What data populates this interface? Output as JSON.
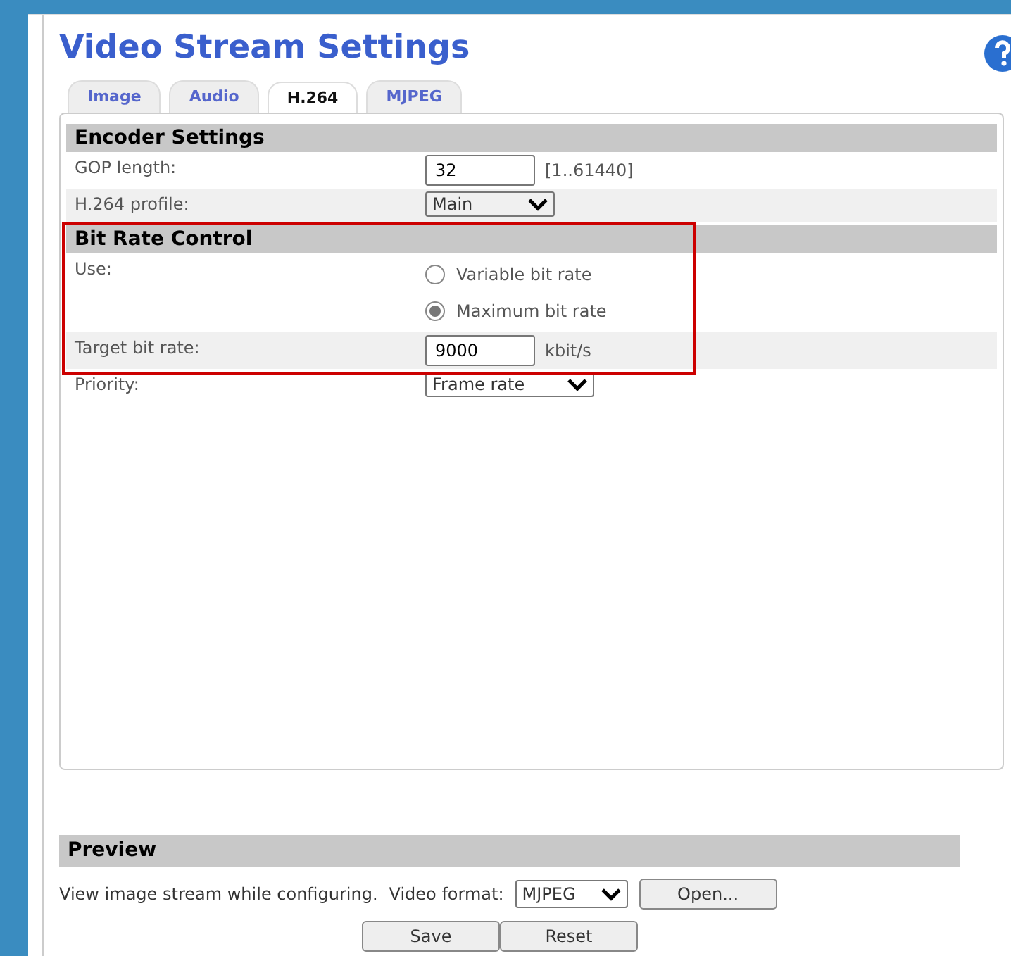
{
  "title": "Video Stream Settings",
  "tabs": [
    {
      "label": "Image",
      "selected": false
    },
    {
      "label": "Audio",
      "selected": false
    },
    {
      "label": "H.264",
      "selected": true
    },
    {
      "label": "MJPEG",
      "selected": false
    }
  ],
  "sections": [
    {
      "heading": "Encoder Settings",
      "rows": [
        {
          "kind": "input",
          "label": "GOP length:",
          "value": "32",
          "hint": "[1..61440]"
        },
        {
          "kind": "select",
          "label": "H.264 profile:",
          "value": "Main"
        }
      ]
    },
    {
      "heading": "Bit Rate Control",
      "highlighted": true,
      "rows": [
        {
          "kind": "radio",
          "label": "Use:",
          "options": [
            {
              "label": "Variable bit rate",
              "selected": false
            },
            {
              "label": "Maximum bit rate",
              "selected": true
            }
          ]
        },
        {
          "kind": "input",
          "label": "Target bit rate:",
          "value": "9000",
          "hint": "kbit/s"
        }
      ]
    },
    {
      "rows": [
        {
          "kind": "select",
          "label": "Priority:",
          "value": "Frame rate"
        }
      ]
    }
  ],
  "preview": {
    "heading": "Preview",
    "text": "View image stream while configuring.",
    "format_label": "Video format:",
    "format_value": "MJPEG",
    "open_button": "Open..."
  },
  "buttons": [
    "Save",
    "Reset"
  ]
}
